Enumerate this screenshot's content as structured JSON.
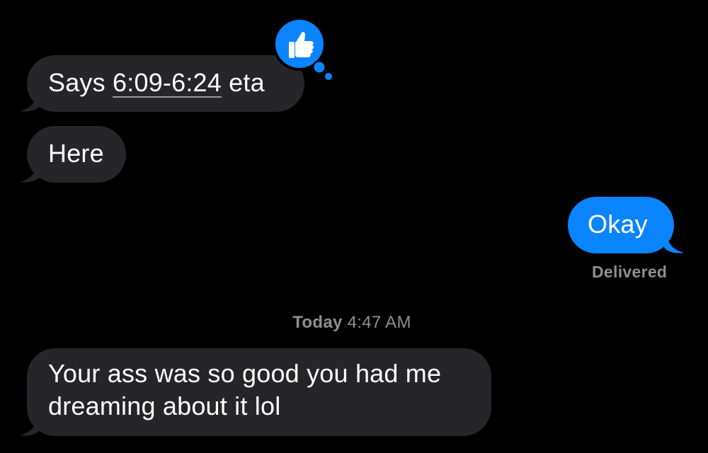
{
  "conversation": {
    "messages": [
      {
        "direction": "incoming",
        "text_before": "Says ",
        "link_text": "6:09-6:24",
        "text_after": " eta",
        "reaction": "thumbs-up-icon"
      },
      {
        "direction": "incoming",
        "text": "Here"
      },
      {
        "direction": "outgoing",
        "text": "Okay",
        "status": "Delivered"
      },
      {
        "direction": "incoming",
        "text": "Your ass was so good you had me dreaming about it lol"
      }
    ],
    "timestamp": {
      "day": "Today",
      "time": "4:47 AM"
    }
  },
  "colors": {
    "background": "#000000",
    "incoming_bubble": "#262628",
    "outgoing_bubble": "#0a84ff",
    "meta_text": "#8e8e93",
    "reaction_badge": "#0a84ff"
  }
}
